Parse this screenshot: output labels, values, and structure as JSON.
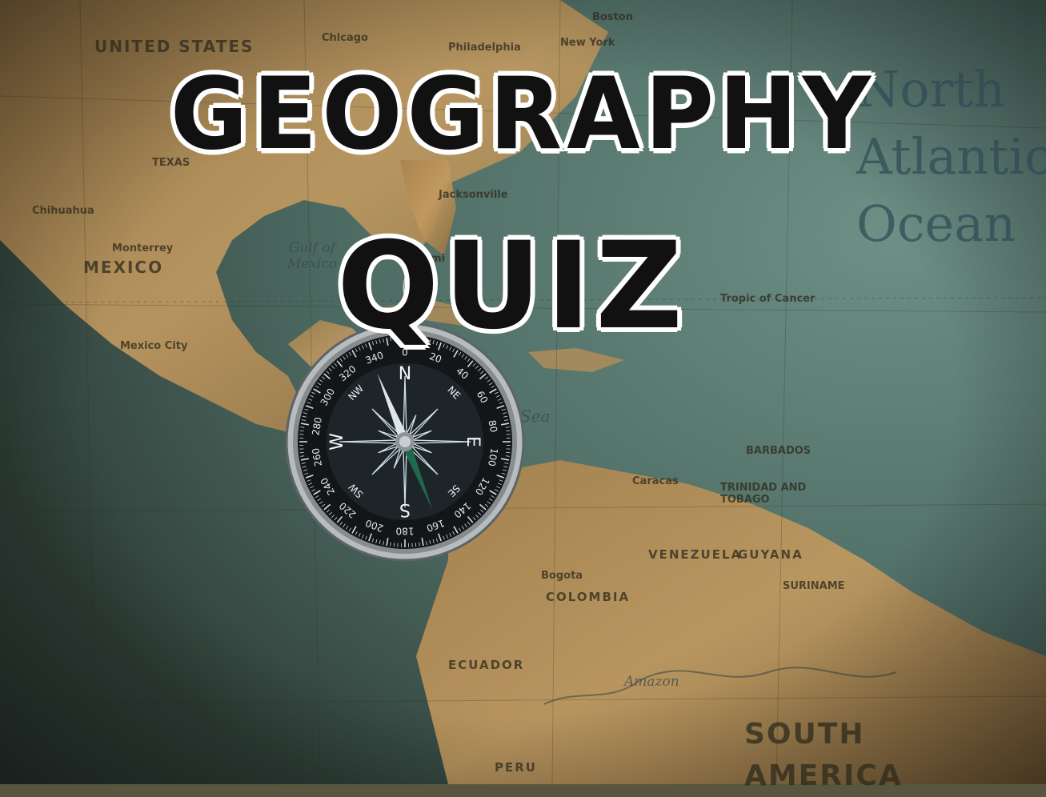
{
  "title": {
    "line1": "GEOGRAPHY",
    "line2": "QUIZ"
  },
  "map_labels": {
    "united_states": "UNITED STATES",
    "mexico": "MEXICO",
    "gulf_of_mexico": "Gulf of Mexico",
    "mexico_city": "Mexico City",
    "colombia": "COLOMBIA",
    "venezuela": "VENEZUELA",
    "guyana": "GUYANA",
    "ecuador": "ECUADOR",
    "peru": "PERU",
    "south_america": "SOUTH AMERICA",
    "north_atlantic_ocean": "North Atlantic Ocean",
    "tropic_of_cancer": "Tropic of Cancer",
    "sea": "Sea",
    "suriname": "SURINAME",
    "amazon": "Amazon",
    "trinidad_and_tobago": "TRINIDAD AND TOBAGO",
    "barbados": "BARBADOS",
    "monterrey": "Monterrey",
    "chihuahua": "Chihuahua",
    "bogota": "Bogota",
    "caracas": "Caracas",
    "jacksonville": "Jacksonville",
    "miami": "Miami",
    "boston": "Boston",
    "philadelphia": "Philadelphia",
    "new_york": "New York",
    "chicago": "Chicago",
    "texas": "TEXAS"
  },
  "compass": {
    "cardinal": [
      "N",
      "E",
      "S",
      "W"
    ],
    "intercardinal": [
      "NE",
      "SE",
      "SW",
      "NW"
    ],
    "degree_labels": [
      "0",
      "20",
      "40",
      "60",
      "80",
      "100",
      "120",
      "140",
      "160",
      "180",
      "200",
      "220",
      "240",
      "260",
      "280",
      "300",
      "320",
      "340"
    ]
  },
  "colors": {
    "land": "#b8925a",
    "ocean": "#4f6f66",
    "title_fill": "#111111",
    "title_outline": "#ffffff",
    "compass_face": "#1c2225",
    "compass_bezel": "#9aa0a3"
  }
}
